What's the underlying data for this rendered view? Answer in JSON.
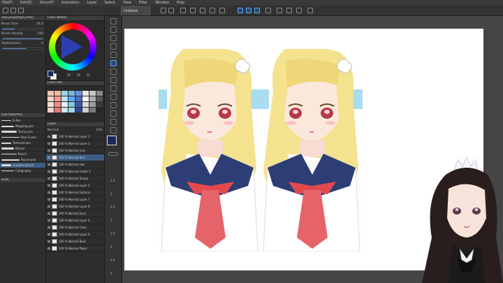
{
  "menu": [
    "File(F)",
    "Edit(E)",
    "Story(P)",
    "Animation",
    "Layer",
    "Select",
    "View",
    "Filter",
    "Window",
    "Help"
  ],
  "toolbar": {
    "doc_tab": "Untitled"
  },
  "color_wheel": {
    "title": "Color Wheel",
    "main_color": "#1f2a5a",
    "sub_color": "#ffffff",
    "h_value": "25",
    "s_value": "45",
    "v_value": "31"
  },
  "color_set": {
    "title": "Color Set",
    "colors": [
      "#f3c6b5",
      "#f2b8a4",
      "#9ad6ea",
      "#7ab8de",
      "#6e8ee0",
      "#e8e8e8",
      "#c8c8c8",
      "#8a8a8a",
      "#ffd4c4",
      "#f59e8d",
      "#bfe3f2",
      "#59a8ff",
      "#4e6ec6",
      "#ffffff",
      "#b0b0b0",
      "#5a5a5a",
      "#fbe1d6",
      "#ed8f86",
      "#e6f4fa",
      "#7fcde8",
      "#3d5aa8",
      "#dcdcdc",
      "#9c9c9c",
      "#3a3a3a",
      "#f7d2c6",
      "#e57c74",
      "#c9eaf6",
      "#9fd8ee",
      "#2e4890",
      "#cfcfcf",
      "#777777",
      "#262626"
    ]
  },
  "tool_property": {
    "title": "Tool property[G-Pen]",
    "brush_size_label": "Brush Size",
    "brush_size_value": "24.0",
    "brush_density_label": "Brush density",
    "brush_density_value": "100",
    "stabilization_label": "Stabilization",
    "stabilization_value": "6",
    "brush_size_level": 0.3,
    "brush_density_level": 1.0,
    "stabilization_level": 0.6
  },
  "subtool": {
    "title": "Sub tool[Pen]",
    "brushes": [
      "G-Pen",
      "Mapping pen",
      "Turnip pen",
      "Real G-pen",
      "Textured pen",
      "Marker",
      "Pencil",
      "Round pen",
      "Gradient brush",
      "Calligraphy"
    ],
    "selected_index": 8
  },
  "layers": {
    "title": "Layer",
    "blend": "Normal",
    "opacity": "100",
    "items": [
      "100 % Normal Layer 3",
      "100 % Normal Layer 2",
      "100 % Normal Line",
      "100 % Normal Skin",
      "100 % Normal Hair",
      "100 % Normal Folder 1",
      "100 % Normal Shade",
      "100 % Normal Layer 5",
      "100 % Normal Uniform",
      "100 % Normal Layer 7",
      "100 % Normal Layer 8",
      "100 % Normal Eyes",
      "100 % Normal Layer 4",
      "100 % Normal Color",
      "100 % Normal Layer 6",
      "100 % Normal Base",
      "100 % Normal Paper"
    ],
    "selected_index": 3
  },
  "ruler_ticks": [
    "3.5",
    "3",
    "2.5",
    "2",
    "1.5",
    "1",
    "0.5",
    "0"
  ],
  "bottom": {
    "zoom": "Auto"
  }
}
